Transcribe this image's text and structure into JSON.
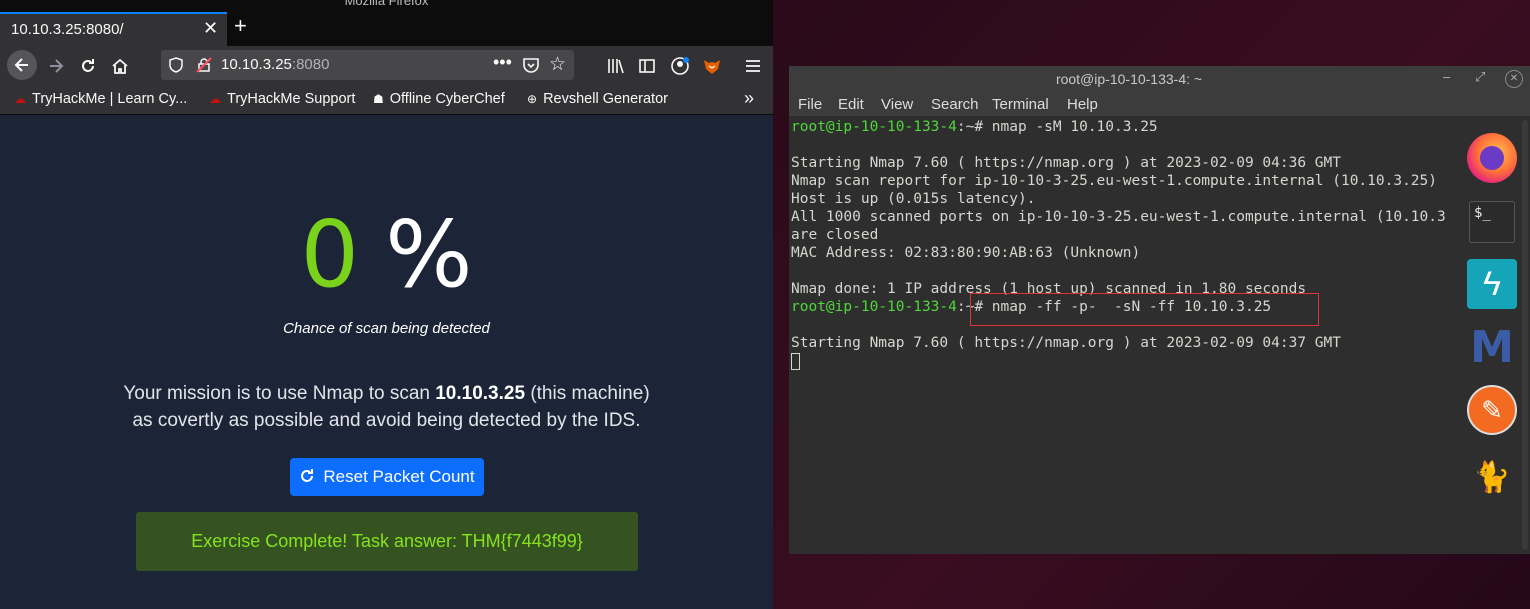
{
  "firefox": {
    "window_title": "Mozilla Firefox",
    "tab_title": "10.10.3.25:8080/",
    "tab_close": "✕",
    "new_tab": "+",
    "url_host": "10.10.3.25",
    "url_port": ":8080",
    "bookmarks": [
      {
        "label": "TryHackMe | Learn Cy...",
        "icon": "tryhackme-icon"
      },
      {
        "label": "TryHackMe Support",
        "icon": "tryhackme-icon"
      },
      {
        "label": "Offline CyberChef",
        "icon": "chef-icon"
      },
      {
        "label": "Revshell Generator",
        "icon": "globe-icon"
      }
    ]
  },
  "page": {
    "detection_value": "0",
    "detection_sign": "%",
    "detection_caption": "Chance of scan being detected",
    "mission_prefix": "Your mission is to use Nmap to scan ",
    "mission_ip": "10.10.3.25",
    "mission_suffix": " (this machine)",
    "mission_line2": "as covertly as possible and avoid being detected by the IDS.",
    "reset_button": "Reset Packet Count",
    "completion_message": "Exercise Complete! Task answer: THM{f7443f99}"
  },
  "terminal": {
    "title": "root@ip-10-10-133-4: ~",
    "menu": [
      "File",
      "Edit",
      "View",
      "Search",
      "Terminal",
      "Help"
    ],
    "prompt": "root@ip-10-10-133-4",
    "prompt_suffix": ":~# ",
    "lines": [
      "nmap -sM 10.10.3.25",
      "",
      "Starting Nmap 7.60 ( https://nmap.org ) at 2023-02-09 04:36 GMT",
      "Nmap scan report for ip-10-10-3-25.eu-west-1.compute.internal (10.10.3.25)",
      "Host is up (0.015s latency).",
      "All 1000 scanned ports on ip-10-10-3-25.eu-west-1.compute.internal (10.10.3",
      "are closed",
      "MAC Address: 02:83:80:90:AB:63 (Unknown)",
      "",
      "Nmap done: 1 IP address (1 host up) scanned in 1.80 seconds",
      "nmap -ff -p-  -sN -ff 10.10.3.25",
      "",
      "Starting Nmap 7.60 ( https://nmap.org ) at 2023-02-09 04:37 GMT"
    ]
  },
  "colors": {
    "accent_green": "#7bd21a",
    "button_blue": "#0d6efd",
    "prompt_green": "#4fd73a",
    "highlight_red": "#e03434"
  }
}
